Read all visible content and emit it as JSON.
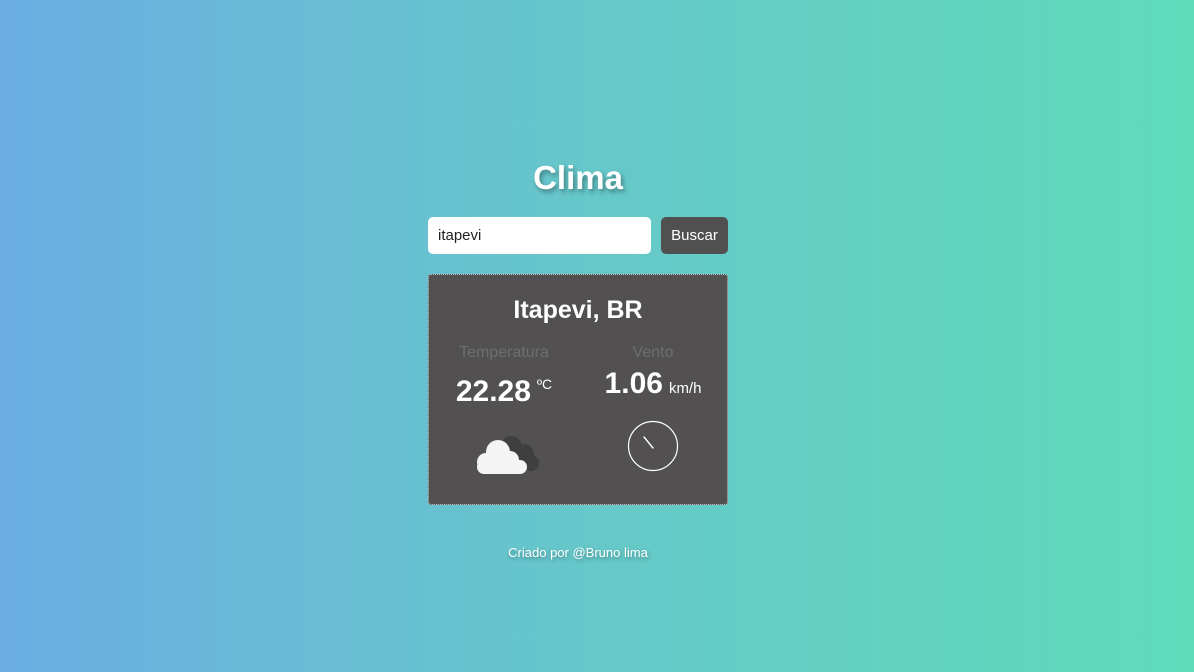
{
  "app": {
    "title": "Clima"
  },
  "search": {
    "value": "itapevi",
    "button_label": "Buscar"
  },
  "weather": {
    "location": "Itapevi, BR",
    "temperature": {
      "label": "Temperatura",
      "value": "22.28",
      "unit": "ºC"
    },
    "wind": {
      "label": "Vento",
      "value": "1.06",
      "unit": "km/h"
    },
    "condition_icon": "cloud-icon",
    "wind_icon": "wind-direction-icon"
  },
  "footer": {
    "credit": "Criado por @Bruno lima"
  },
  "colors": {
    "card_background": "#525051",
    "button_background": "#505050",
    "gradient_start": "#6aaee2",
    "gradient_end": "#5edcb9"
  }
}
